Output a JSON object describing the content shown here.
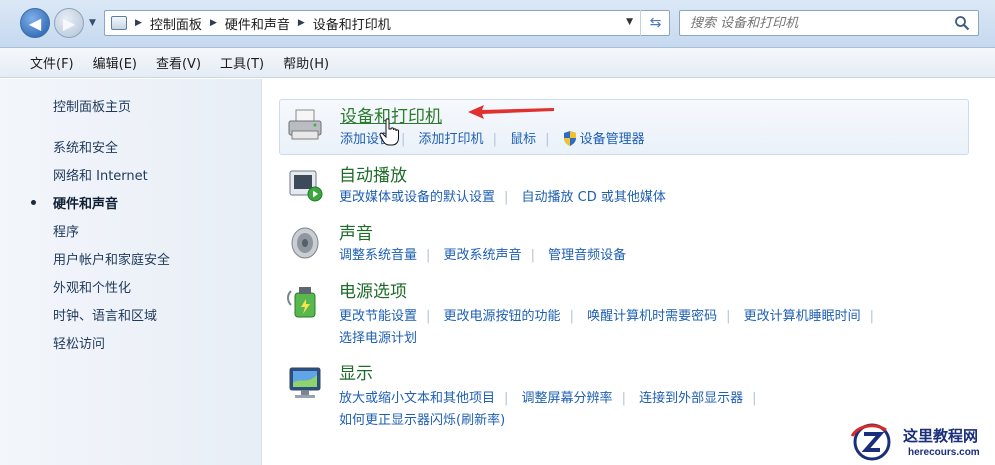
{
  "address": {
    "breadcrumbs": [
      "控制面板",
      "硬件和声音",
      "设备和打印机"
    ],
    "search_placeholder": "搜索 设备和打印机"
  },
  "menu": [
    "文件(F)",
    "编辑(E)",
    "查看(V)",
    "工具(T)",
    "帮助(H)"
  ],
  "sidebar": {
    "home": "控制面板主页",
    "items": [
      {
        "label": "系统和安全",
        "active": false
      },
      {
        "label": "网络和 Internet",
        "active": false
      },
      {
        "label": "硬件和声音",
        "active": true
      },
      {
        "label": "程序",
        "active": false
      },
      {
        "label": "用户帐户和家庭安全",
        "active": false
      },
      {
        "label": "外观和个性化",
        "active": false
      },
      {
        "label": "时钟、语言和区域",
        "active": false
      },
      {
        "label": "轻松访问",
        "active": false
      }
    ]
  },
  "categories": [
    {
      "title": "设备和打印机",
      "links": [
        "添加设备",
        "添加打印机",
        "鼠标",
        "设备管理器"
      ],
      "icon": "printer-icon"
    },
    {
      "title": "自动播放",
      "links": [
        "更改媒体或设备的默认设置",
        "自动播放 CD 或其他媒体"
      ],
      "icon": "autoplay-icon"
    },
    {
      "title": "声音",
      "links": [
        "调整系统音量",
        "更改系统声音",
        "管理音频设备"
      ],
      "icon": "speaker-icon"
    },
    {
      "title": "电源选项",
      "links": [
        "更改节能设置",
        "更改电源按钮的功能",
        "唤醒计算机时需要密码",
        "更改计算机睡眠时间",
        "选择电源计划"
      ],
      "icon": "power-icon"
    },
    {
      "title": "显示",
      "links": [
        "放大或缩小文本和其他项目",
        "调整屏幕分辨率",
        "连接到外部显示器",
        "如何更正显示器闪烁(刷新率)"
      ],
      "icon": "monitor-icon"
    }
  ],
  "watermark": {
    "text": "这里教程网",
    "url": "herecours.com"
  },
  "colors": {
    "link": "#1e5fb3",
    "category_title": "#1e6b2a",
    "annotation_arrow": "#e03030"
  }
}
